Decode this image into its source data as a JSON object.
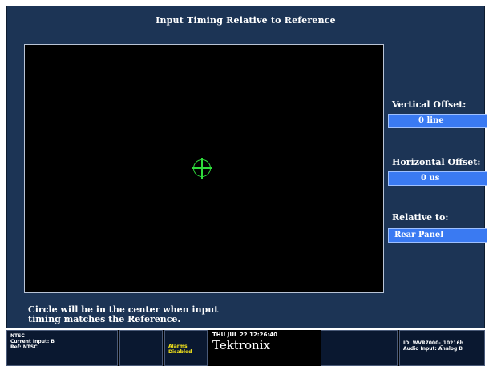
{
  "title": "Input Timing Relative to Reference",
  "vertical_offset": {
    "label": "Vertical Offset:",
    "value": "0 line"
  },
  "horizontal_offset": {
    "label": "Horizontal Offset:",
    "value": "0 us"
  },
  "relative_to": {
    "label": "Relative to:",
    "value": "Rear Panel"
  },
  "hint": "Circle will be in the center when input\ntiming matches the Reference.",
  "status": {
    "format": "NTSC",
    "input": "Current Input: B",
    "ref": "Ref: NTSC",
    "alarms_line1": "Alarms",
    "alarms_line2": "Disabled",
    "datetime": "THU JUL 22 12:26:40",
    "brand": "Tektronix",
    "id": "ID: WVR7000-_10216b",
    "audio_input": "Audio Input: Analog B"
  },
  "colors": {
    "panel": "#1c3455",
    "value_box": "#3a7af2",
    "target": "#2fdc3c",
    "alarm_text": "#f4e41a"
  }
}
